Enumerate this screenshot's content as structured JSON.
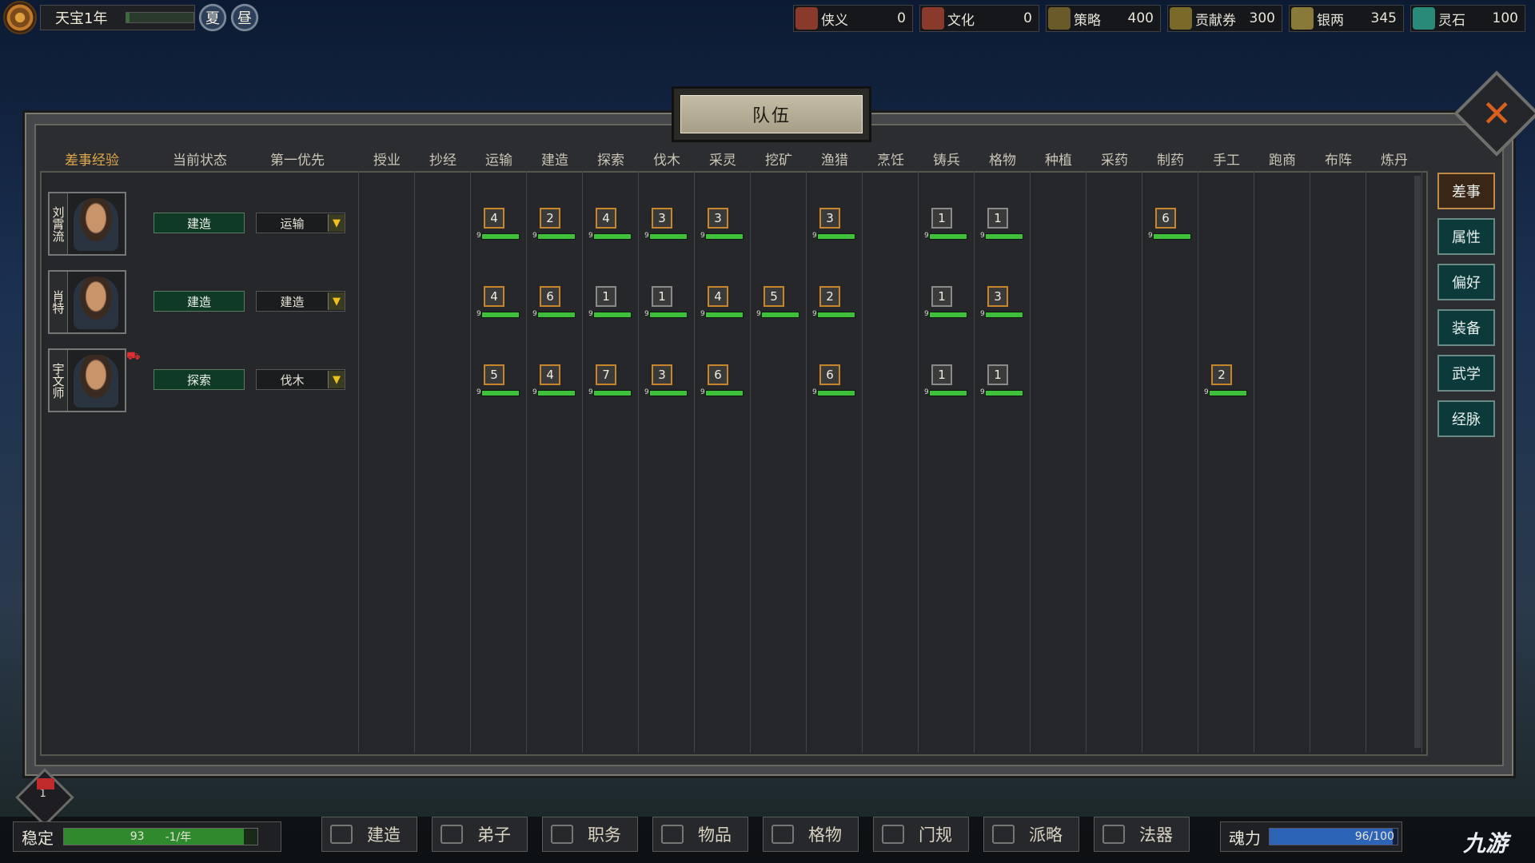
{
  "topbar": {
    "date": "天宝1年",
    "date_progress": 0.05,
    "season": "夏",
    "time_of_day": "昼",
    "resources": [
      {
        "label": "侠义",
        "value": "0",
        "icon": "sword-icon",
        "color": "#8a3a2a"
      },
      {
        "label": "文化",
        "value": "0",
        "icon": "brush-icon",
        "color": "#8a3a2a"
      },
      {
        "label": "策略",
        "value": "400",
        "icon": "strategy-icon",
        "color": "#6a5a2a"
      },
      {
        "label": "贡献券",
        "value": "300",
        "icon": "coupon-icon",
        "color": "#7a6a2a"
      },
      {
        "label": "银两",
        "value": "345",
        "icon": "silver-icon",
        "color": "#8a7a3a"
      },
      {
        "label": "灵石",
        "value": "100",
        "icon": "spirit-stone-icon",
        "color": "#2a8a7a"
      }
    ]
  },
  "panel": {
    "title": "队伍",
    "headers": [
      "差事经验",
      "当前状态",
      "第一优先",
      "授业",
      "抄经",
      "运输",
      "建造",
      "探索",
      "伐木",
      "采灵",
      "挖矿",
      "渔猎",
      "烹饪",
      "铸兵",
      "格物",
      "种植",
      "采药",
      "制药",
      "手工",
      "跑商",
      "布阵",
      "炼丹"
    ],
    "rows": [
      {
        "name": "刘霄流",
        "status": "建造",
        "priority": "运输",
        "flag": false,
        "skills": [
          {
            "col": "运输",
            "level": "4",
            "max": "9",
            "highlight": true
          },
          {
            "col": "建造",
            "level": "2",
            "max": "9",
            "highlight": true
          },
          {
            "col": "探索",
            "level": "4",
            "max": "9",
            "highlight": true
          },
          {
            "col": "伐木",
            "level": "3",
            "max": "9",
            "highlight": true
          },
          {
            "col": "采灵",
            "level": "3",
            "max": "9",
            "highlight": true
          },
          {
            "col": "渔猎",
            "level": "3",
            "max": "9",
            "highlight": true
          },
          {
            "col": "铸兵",
            "level": "1",
            "max": "9",
            "highlight": false
          },
          {
            "col": "格物",
            "level": "1",
            "max": "9",
            "highlight": false
          },
          {
            "col": "制药",
            "level": "6",
            "max": "9",
            "highlight": true
          }
        ]
      },
      {
        "name": "肖特",
        "status": "建造",
        "priority": "建造",
        "flag": false,
        "skills": [
          {
            "col": "运输",
            "level": "4",
            "max": "9",
            "highlight": true
          },
          {
            "col": "建造",
            "level": "6",
            "max": "9",
            "highlight": true
          },
          {
            "col": "探索",
            "level": "1",
            "max": "9",
            "highlight": false
          },
          {
            "col": "伐木",
            "level": "1",
            "max": "9",
            "highlight": false
          },
          {
            "col": "采灵",
            "level": "4",
            "max": "9",
            "highlight": true
          },
          {
            "col": "挖矿",
            "level": "5",
            "max": "9",
            "highlight": true
          },
          {
            "col": "渔猎",
            "level": "2",
            "max": "9",
            "highlight": true
          },
          {
            "col": "铸兵",
            "level": "1",
            "max": "9",
            "highlight": false
          },
          {
            "col": "格物",
            "level": "3",
            "max": "9",
            "highlight": true
          }
        ]
      },
      {
        "name": "宇文师",
        "status": "探索",
        "priority": "伐木",
        "flag": true,
        "skills": [
          {
            "col": "运输",
            "level": "5",
            "max": "9",
            "highlight": true
          },
          {
            "col": "建造",
            "level": "4",
            "max": "9",
            "highlight": true
          },
          {
            "col": "探索",
            "level": "7",
            "max": "9",
            "highlight": true
          },
          {
            "col": "伐木",
            "level": "3",
            "max": "9",
            "highlight": true
          },
          {
            "col": "采灵",
            "level": "6",
            "max": "9",
            "highlight": true
          },
          {
            "col": "渔猎",
            "level": "6",
            "max": "9",
            "highlight": true
          },
          {
            "col": "铸兵",
            "level": "1",
            "max": "9",
            "highlight": false
          },
          {
            "col": "格物",
            "level": "1",
            "max": "9",
            "highlight": false
          },
          {
            "col": "手工",
            "level": "2",
            "max": "9",
            "highlight": true
          }
        ]
      }
    ]
  },
  "side_tabs": [
    {
      "label": "差事",
      "active": true
    },
    {
      "label": "属性",
      "active": false
    },
    {
      "label": "偏好",
      "active": false
    },
    {
      "label": "装备",
      "active": false
    },
    {
      "label": "武学",
      "active": false
    },
    {
      "label": "经脉",
      "active": false
    }
  ],
  "bottom": {
    "party_count": "1",
    "stability": {
      "label": "稳定",
      "value": "93",
      "rate": "-1/年",
      "fraction": 0.93
    },
    "menu": [
      {
        "label": "建造",
        "icon": "build-icon"
      },
      {
        "label": "弟子",
        "icon": "disciple-icon"
      },
      {
        "label": "职务",
        "icon": "duty-icon"
      },
      {
        "label": "物品",
        "icon": "item-icon"
      },
      {
        "label": "格物",
        "icon": "craft-icon"
      },
      {
        "label": "门规",
        "icon": "rules-icon"
      },
      {
        "label": "派略",
        "icon": "strategy-icon"
      },
      {
        "label": "法器",
        "icon": "artifact-icon"
      }
    ],
    "soul": {
      "label": "魂力",
      "value": "96/100",
      "fraction": 0.96
    },
    "watermark": "九游"
  }
}
